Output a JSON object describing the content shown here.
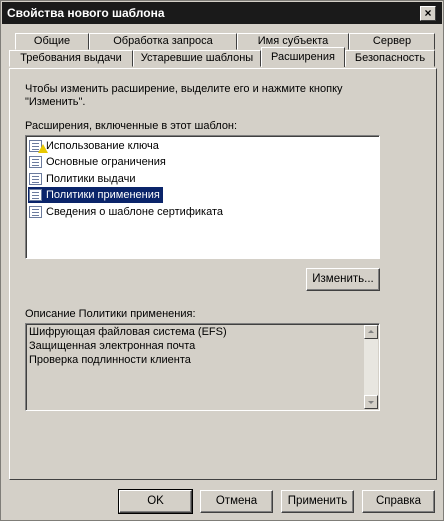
{
  "window": {
    "title": "Свойства нового шаблона",
    "close_glyph": "×"
  },
  "tabs": {
    "row1": [
      "Общие",
      "Обработка запроса",
      "Имя субъекта",
      "Сервер"
    ],
    "row2": [
      "Требования выдачи",
      "Устаревшие шаблоны",
      "Расширения",
      "Безопасность"
    ],
    "active": "Расширения"
  },
  "content": {
    "instruction_line1": "Чтобы изменить расширение, выделите его и нажмите кнопку",
    "instruction_line2": "\"Изменить\".",
    "list_label": "Расширения, включенные в  этот шаблон:",
    "extensions": [
      {
        "label": "Использование ключа",
        "icon": "warning-icon"
      },
      {
        "label": "Основные ограничения",
        "icon": "document-icon"
      },
      {
        "label": "Политики выдачи",
        "icon": "document-icon"
      },
      {
        "label": "Политики применения",
        "icon": "document-icon",
        "selected": true
      },
      {
        "label": "Сведения о шаблоне сертификата",
        "icon": "document-icon"
      }
    ],
    "edit_button": "Изменить...",
    "description_label": "Описание Политики применения:",
    "description_lines": [
      "Шифрующая файловая система (EFS)",
      "Защищенная электронная почта",
      "Проверка подлинности клиента"
    ]
  },
  "footer": {
    "ok": "OK",
    "cancel": "Отмена",
    "apply": "Применить",
    "help": "Справка"
  },
  "colors": {
    "face": "#d4d0c8",
    "selection": "#0a246a",
    "titlebar": "#1a1a1a"
  }
}
